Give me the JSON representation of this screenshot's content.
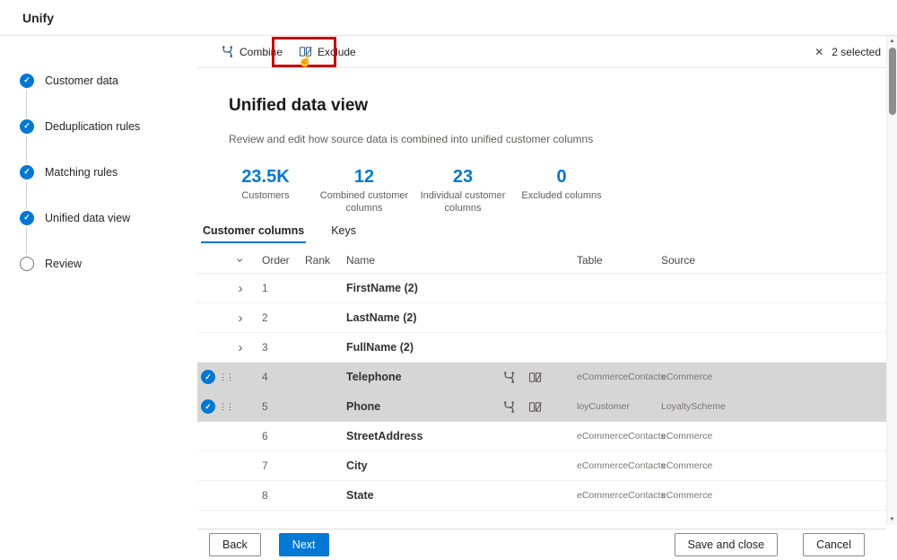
{
  "app": {
    "title": "Unify"
  },
  "colors": {
    "accent": "#0078d4",
    "annotation": "#c80000",
    "selected_row_bg": "#d6d6d6"
  },
  "icons": {
    "check": "✓",
    "close": "✕",
    "chevron_right": "›",
    "drag": "⋮⋮",
    "cursor": "☝",
    "scroll_up": "▲",
    "scroll_down": "▼"
  },
  "stepper": {
    "items": [
      {
        "label": "Customer data",
        "state": "complete"
      },
      {
        "label": "Deduplication rules",
        "state": "complete"
      },
      {
        "label": "Matching rules",
        "state": "complete"
      },
      {
        "label": "Unified data view",
        "state": "current"
      },
      {
        "label": "Review",
        "state": "upcoming"
      }
    ]
  },
  "toolbar": {
    "combine_label": "Combine",
    "exclude_label": "Exclude",
    "selected_text": "2 selected"
  },
  "page": {
    "title": "Unified data view",
    "subtitle": "Review and edit how source data is combined into unified customer columns"
  },
  "stats": [
    {
      "value": "23.5K",
      "label": "Customers"
    },
    {
      "value": "12",
      "label": "Combined customer columns"
    },
    {
      "value": "23",
      "label": "Individual customer columns"
    },
    {
      "value": "0",
      "label": "Excluded columns"
    }
  ],
  "tabs": [
    {
      "label": "Customer columns",
      "active": true
    },
    {
      "label": "Keys",
      "active": false
    }
  ],
  "table": {
    "headers": {
      "order": "Order",
      "rank": "Rank",
      "name": "Name",
      "table": "Table",
      "source": "Source"
    },
    "rows": [
      {
        "order": "1",
        "name": "FirstName (2)",
        "expandable": true
      },
      {
        "order": "2",
        "name": "LastName (2)",
        "expandable": true
      },
      {
        "order": "3",
        "name": "FullName (2)",
        "expandable": true
      },
      {
        "order": "4",
        "name": "Telephone",
        "table": "eCommerceContacts",
        "source": "eCommerce",
        "selected": true
      },
      {
        "order": "5",
        "name": "Phone",
        "table": "loyCustomer",
        "source": "LoyaltyScheme",
        "selected": true
      },
      {
        "order": "6",
        "name": "StreetAddress",
        "table": "eCommerceContacts",
        "source": "eCommerce"
      },
      {
        "order": "7",
        "name": "City",
        "table": "eCommerceContacts",
        "source": "eCommerce"
      },
      {
        "order": "8",
        "name": "State",
        "table": "eCommerceContacts",
        "source": "eCommerce"
      }
    ]
  },
  "footer": {
    "back_label": "Back",
    "next_label": "Next",
    "save_label": "Save and close",
    "cancel_label": "Cancel"
  }
}
